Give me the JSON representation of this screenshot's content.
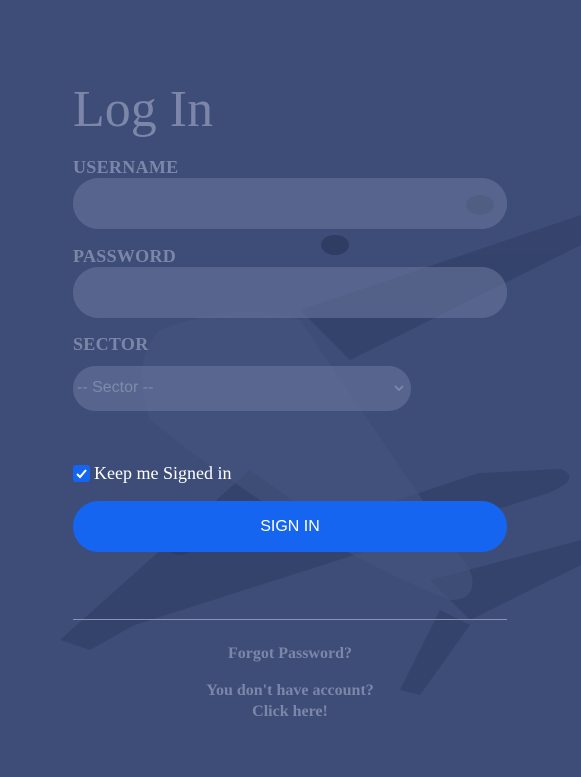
{
  "login": {
    "title": "Log In",
    "username_label": "USERNAME",
    "username_value": "",
    "password_label": "PASSWORD",
    "password_value": "",
    "sector_label": "SECTOR",
    "sector_selected": "-- Sector --",
    "keep_signed_in_label": "Keep me Signed in",
    "keep_signed_in_checked": true,
    "sign_in_label": "SIGN IN",
    "forgot_password": "Forgot Password?",
    "no_account": "You don't have account?",
    "click_here": "Click here!"
  },
  "colors": {
    "background": "#3d4d78",
    "accent": "#1565f0",
    "muted_text": "#7c86a8"
  },
  "icons": [
    "airplane-background-image",
    "chevron-down-icon",
    "checkmark-icon"
  ]
}
